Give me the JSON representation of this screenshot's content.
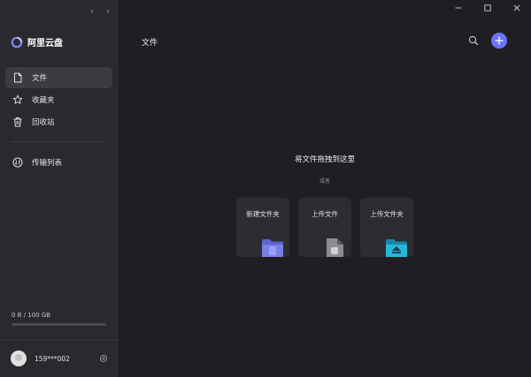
{
  "app": {
    "name": "阿里云盘",
    "brand_color": "#6a72ff"
  },
  "sidebar": {
    "items": [
      {
        "label": "文件",
        "icon": "file-icon",
        "active": true
      },
      {
        "label": "收藏夹",
        "icon": "star-icon",
        "active": false
      },
      {
        "label": "回收站",
        "icon": "trash-icon",
        "active": false
      }
    ],
    "transfer": {
      "label": "传输列表",
      "icon": "transfer-icon"
    },
    "storage": {
      "text": "0 B / 100 GB",
      "used_fraction": 0.0
    },
    "user": {
      "name": "159***002"
    }
  },
  "header": {
    "title": "文件"
  },
  "main": {
    "drop_title": "将文件拖拽到这里",
    "drop_or": "或者",
    "actions": [
      {
        "label": "新建文件夹",
        "icon": "new-folder-icon"
      },
      {
        "label": "上传文件",
        "icon": "upload-file-icon"
      },
      {
        "label": "上传文件夹",
        "icon": "upload-folder-icon"
      }
    ]
  }
}
